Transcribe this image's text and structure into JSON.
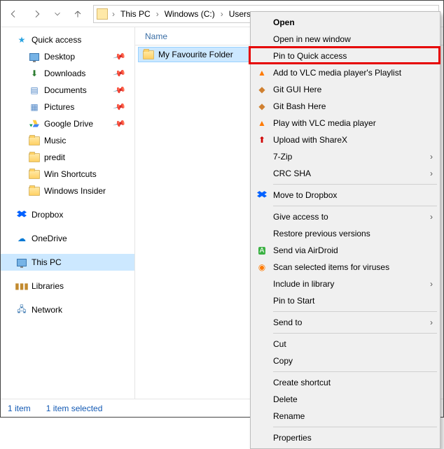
{
  "breadcrumb": {
    "root": "This PC",
    "items": [
      "Windows (C:)",
      "Users"
    ]
  },
  "columns": {
    "name": "Name"
  },
  "nav": {
    "quick_access": "Quick access",
    "items": [
      {
        "label": "Desktop",
        "pin": true
      },
      {
        "label": "Downloads",
        "pin": true
      },
      {
        "label": "Documents",
        "pin": true
      },
      {
        "label": "Pictures",
        "pin": true
      },
      {
        "label": "Google Drive",
        "pin": true
      },
      {
        "label": "Music",
        "pin": false
      },
      {
        "label": "predit",
        "pin": false
      },
      {
        "label": "Win Shortcuts",
        "pin": false
      },
      {
        "label": "Windows Insider",
        "pin": false
      }
    ],
    "dropbox": "Dropbox",
    "onedrive": "OneDrive",
    "thispc": "This PC",
    "libraries": "Libraries",
    "network": "Network"
  },
  "files": [
    {
      "name": "My Favourite Folder"
    }
  ],
  "status": {
    "count": "1 item",
    "selected": "1 item selected"
  },
  "context_menu": [
    {
      "label": "Open",
      "bold": true
    },
    {
      "label": "Open in new window"
    },
    {
      "label": "Pin to Quick access",
      "highlight": true
    },
    {
      "label": "Add to VLC media player's Playlist",
      "icon": "vlc"
    },
    {
      "label": "Git GUI Here",
      "icon": "git"
    },
    {
      "label": "Git Bash Here",
      "icon": "git"
    },
    {
      "label": "Play with VLC media player",
      "icon": "vlc"
    },
    {
      "label": "Upload with ShareX",
      "icon": "sharex"
    },
    {
      "label": "7-Zip",
      "submenu": true
    },
    {
      "label": "CRC SHA",
      "submenu": true
    },
    {
      "sep": true
    },
    {
      "label": "Move to Dropbox",
      "icon": "dropbox"
    },
    {
      "sep": true
    },
    {
      "label": "Give access to",
      "submenu": true
    },
    {
      "label": "Restore previous versions"
    },
    {
      "label": "Send via AirDroid",
      "icon": "airdroid"
    },
    {
      "label": "Scan selected items for viruses",
      "icon": "avast"
    },
    {
      "label": "Include in library",
      "submenu": true
    },
    {
      "label": "Pin to Start"
    },
    {
      "sep": true
    },
    {
      "label": "Send to",
      "submenu": true
    },
    {
      "sep": true
    },
    {
      "label": "Cut"
    },
    {
      "label": "Copy"
    },
    {
      "sep": true
    },
    {
      "label": "Create shortcut"
    },
    {
      "label": "Delete"
    },
    {
      "label": "Rename"
    },
    {
      "sep": true
    },
    {
      "label": "Properties"
    }
  ]
}
